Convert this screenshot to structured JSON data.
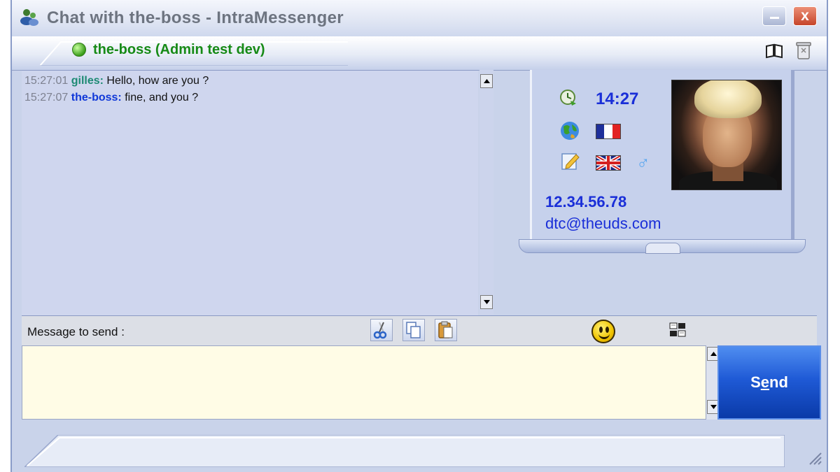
{
  "window": {
    "title": "Chat with the-boss  -  IntraMessenger",
    "minimize_icon": "minimize-icon",
    "close_label": "x"
  },
  "contact": {
    "name": "the-boss (Admin test dev)",
    "status_icon": "online-status-icon",
    "status_color": "#3a9d1a"
  },
  "chat": {
    "messages": [
      {
        "time": "15:27:01",
        "sender": "gilles:",
        "text": "Hello, how are you ?"
      },
      {
        "time": "15:27:07",
        "sender": "the-boss:",
        "text": "fine, and you ?"
      }
    ]
  },
  "info": {
    "local_time": "14:27",
    "country_flag": "flag-france",
    "language_flag": "flag-uk",
    "gender": "♂",
    "ip": "12.34.56.78",
    "email": "dtc@theuds.com"
  },
  "compose": {
    "label": "Message to send :",
    "value": "",
    "tools": [
      "cut-icon",
      "copy-icon",
      "paste-icon",
      "smiley-icon",
      "format-icon"
    ],
    "send_prefix": "S",
    "send_underlined": "e",
    "send_suffix": "nd"
  },
  "colors": {
    "accent": "#1a2fd8",
    "send": "#1f5ad6",
    "chat_bg": "#cfd6ee",
    "input_bg": "#fffce6"
  }
}
